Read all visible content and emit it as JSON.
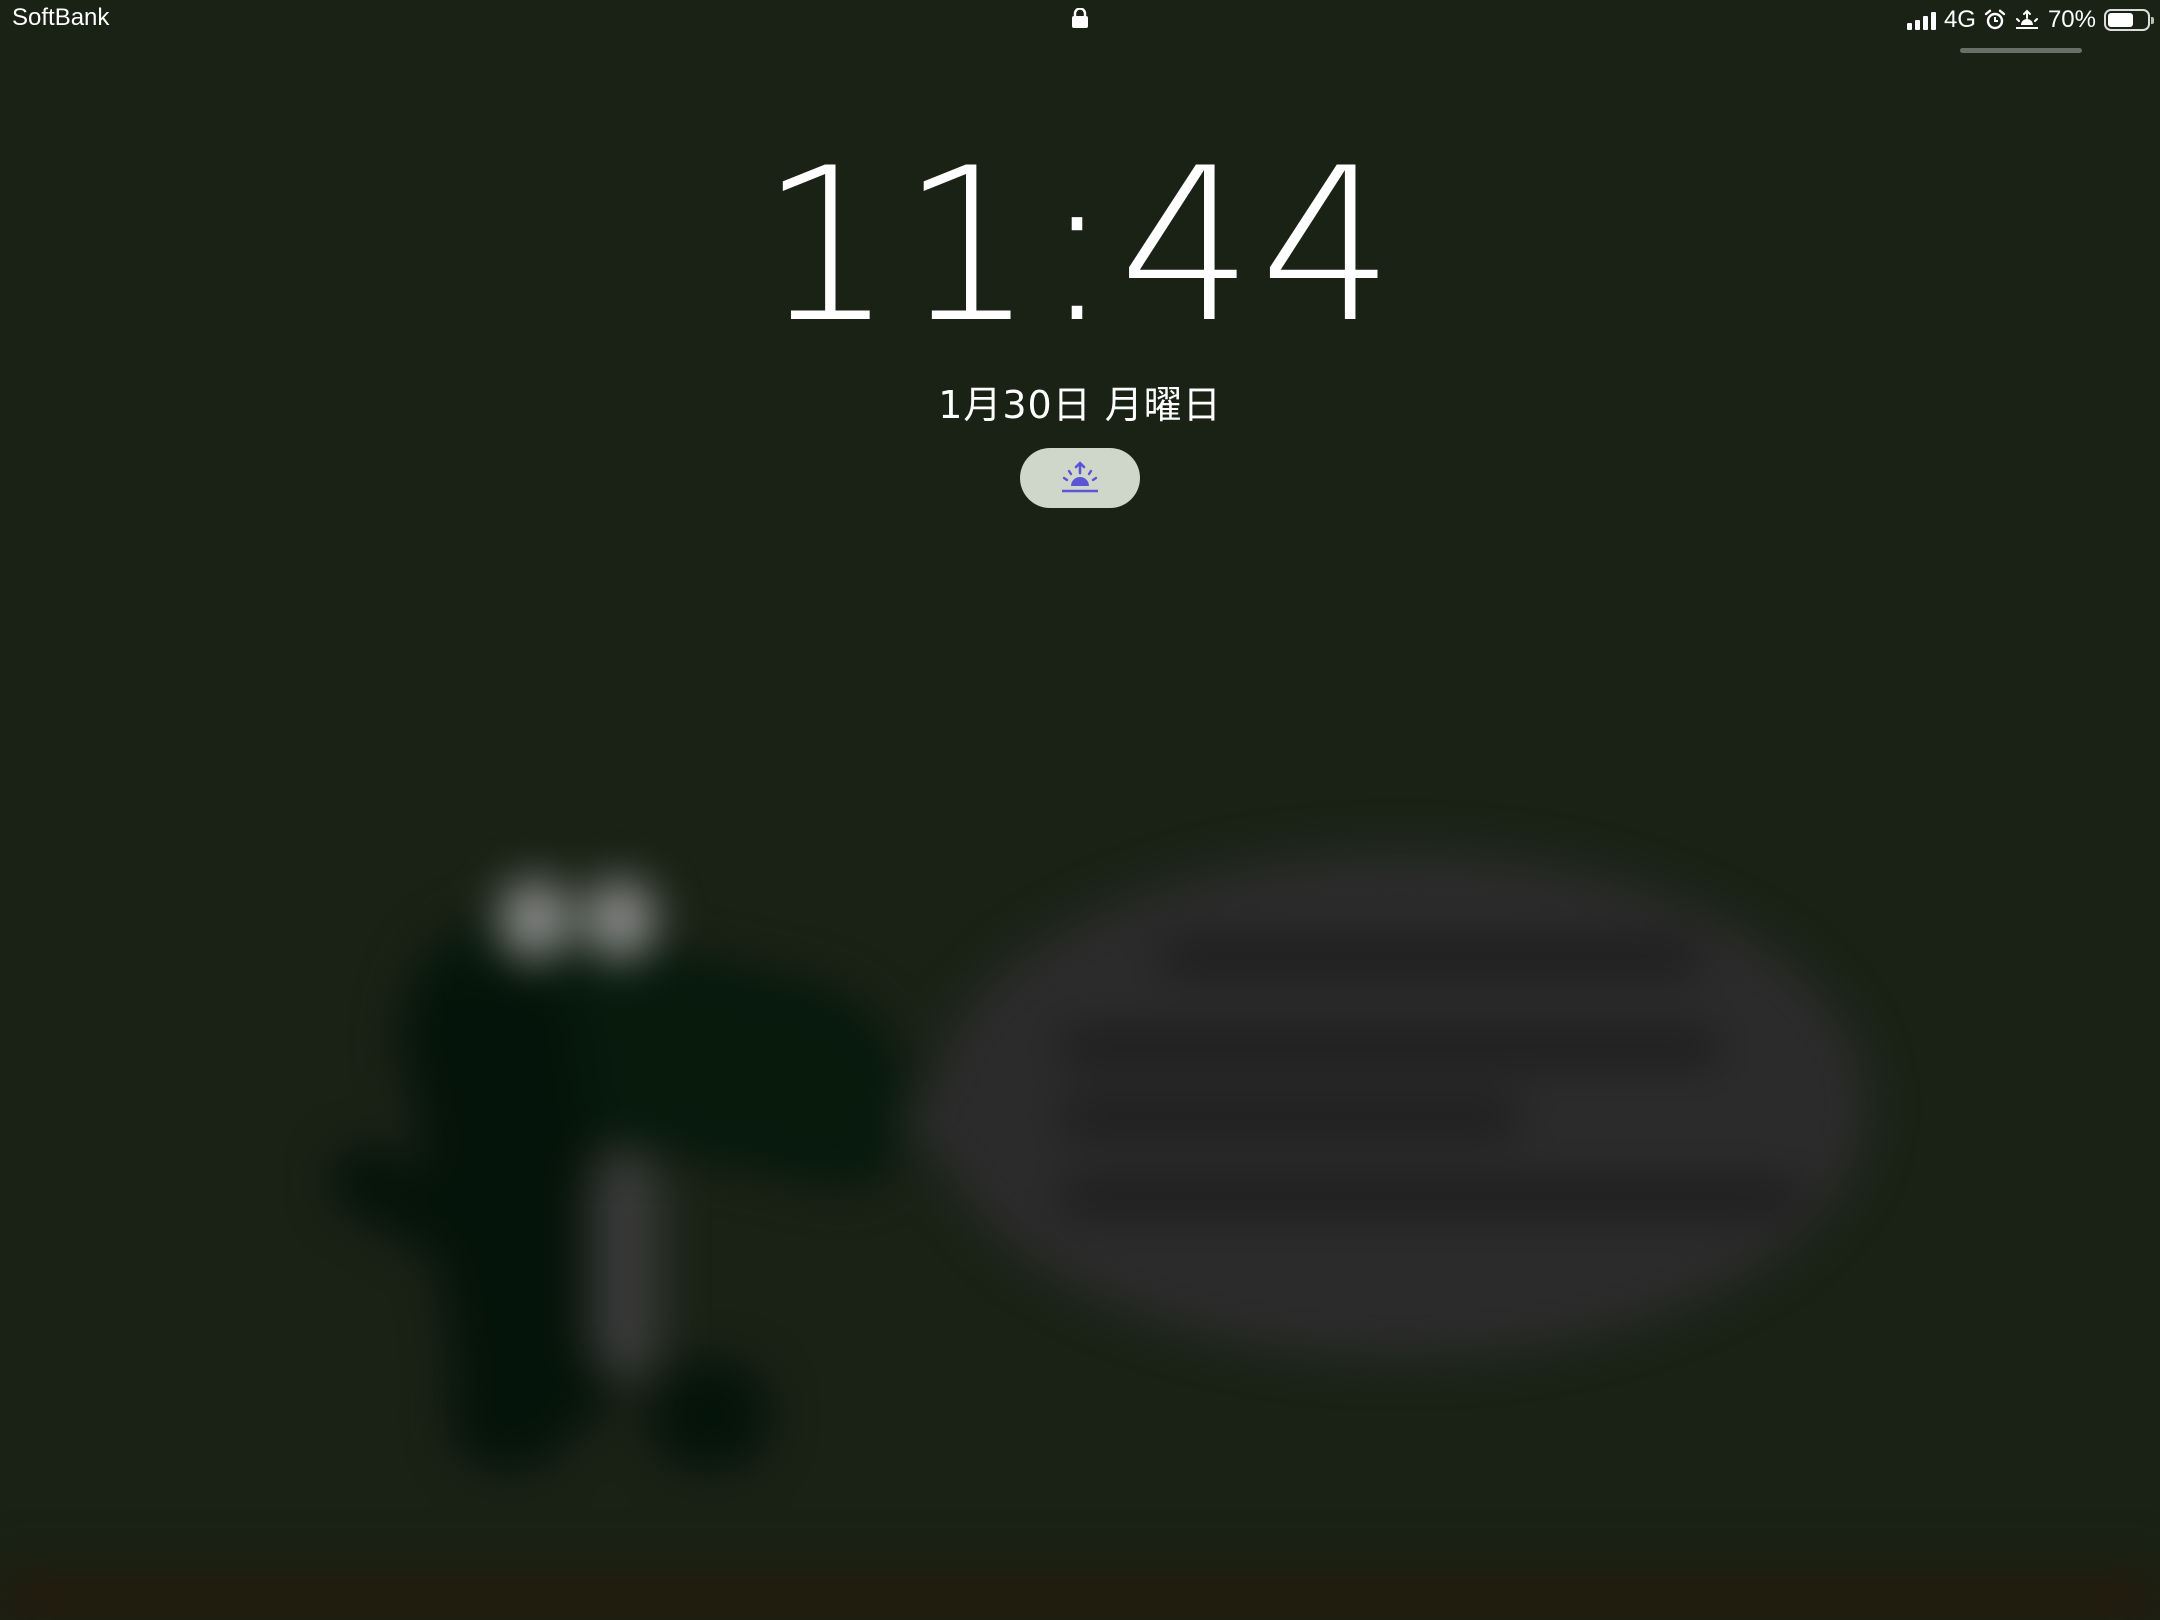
{
  "status_bar": {
    "carrier": "SoftBank",
    "network": "4G",
    "battery": "70%",
    "battery_level": 0.7,
    "icons": [
      "lock-icon",
      "signal-icon",
      "alarm-icon",
      "sleep-focus-icon",
      "battery-icon"
    ]
  },
  "lock_screen": {
    "time": "11:44",
    "date": "1月30日 月曜日",
    "focus_icon": "sleep-focus-icon"
  },
  "colors": {
    "background": "#1a2215",
    "focus_pill": "#cfd6ca",
    "focus_icon": "#5b55d6"
  }
}
